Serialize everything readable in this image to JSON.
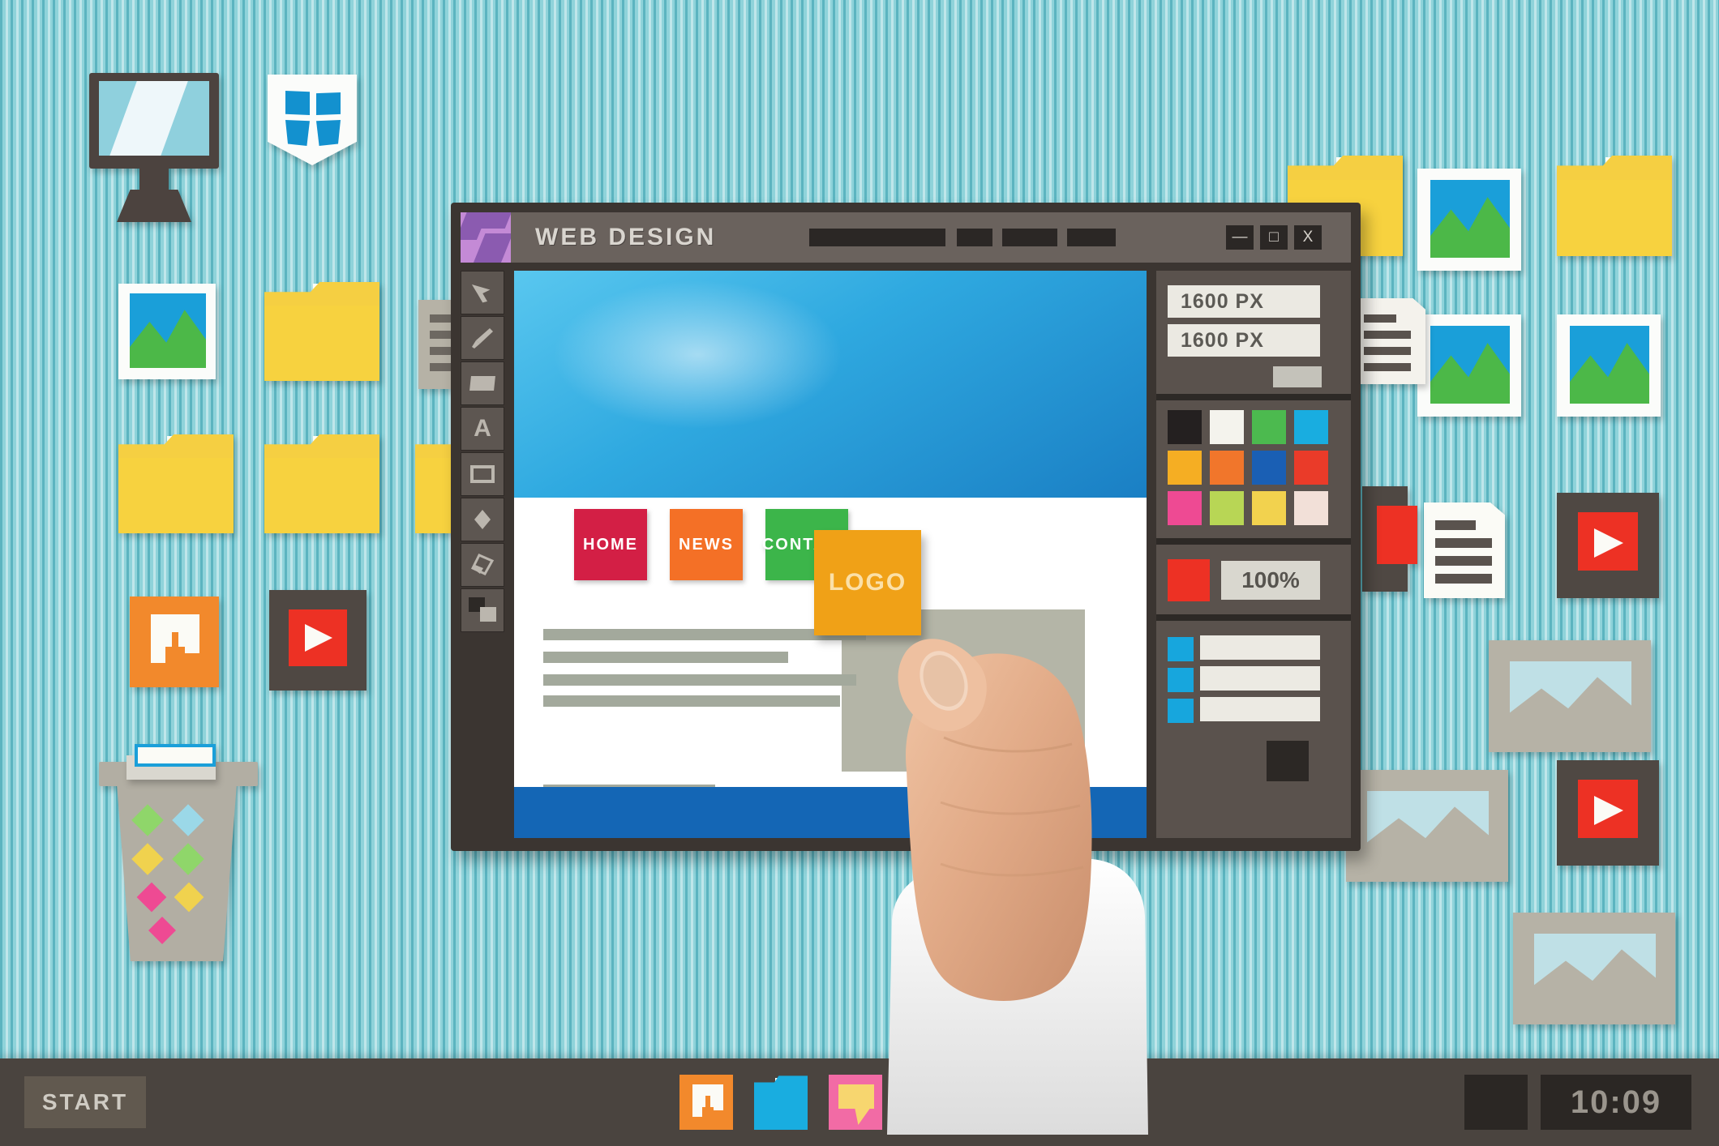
{
  "window": {
    "title": "WEB DESIGN",
    "logo_icon": "app-logo-icon",
    "controls": {
      "minimize": "—",
      "maximize": "□",
      "close": "X"
    }
  },
  "toolbar": {
    "tools": [
      {
        "name": "cursor-tool",
        "icon": "cursor-arrow-icon"
      },
      {
        "name": "brush-tool",
        "icon": "paintbrush-icon"
      },
      {
        "name": "fill-rect-tool",
        "icon": "filled-rectangle-icon"
      },
      {
        "name": "text-tool",
        "icon": "text-a-icon",
        "glyph": "A"
      },
      {
        "name": "rectangle-tool",
        "icon": "rectangle-outline-icon"
      },
      {
        "name": "shape-tool",
        "icon": "diamond-icon"
      },
      {
        "name": "eraser-tool",
        "icon": "eraser-icon"
      },
      {
        "name": "color-swatch-tool",
        "icon": "two-squares-icon"
      }
    ]
  },
  "canvas": {
    "nav": [
      {
        "label": "HOME",
        "color": "#d31f45"
      },
      {
        "label": "NEWS",
        "color": "#f47026"
      },
      {
        "label": "CONTACT",
        "color": "#3cb54a"
      }
    ],
    "logo_card": {
      "label": "LOGO",
      "color": "#f0a117"
    },
    "hero_color": "#2fa9e0",
    "footer_color": "#1466b5"
  },
  "side_panel": {
    "width_field": {
      "value": "1600 PX",
      "name": "width-field"
    },
    "height_field": {
      "value": "1600 PX",
      "name": "height-field"
    },
    "zoom": {
      "value": "100%",
      "swatch_color": "#ed3124"
    },
    "palette": [
      [
        "#242020",
        "#f4f3ed",
        "#4cba4f",
        "#19ade0"
      ],
      [
        "#f5ae23",
        "#f1762b",
        "#1a5fb4",
        "#ea3b29"
      ],
      [
        "#ee4a93",
        "#b8d655",
        "#f2d24e",
        "#f2e0d8"
      ]
    ],
    "layers": [
      {
        "marker": "#17a6dd"
      },
      {
        "marker": "#17a6dd"
      },
      {
        "marker": "#17a6dd"
      }
    ]
  },
  "taskbar": {
    "start_label": "START",
    "clock": "10:09",
    "icons": [
      {
        "name": "music-icon",
        "color": "#f2892c"
      },
      {
        "name": "folder-icon",
        "color": "#19ade0"
      },
      {
        "name": "chat-icon",
        "color": "#f26ba5"
      },
      {
        "name": "video-icon",
        "color": "#c9291f"
      }
    ]
  },
  "desktop_icons": [
    {
      "name": "monitor-icon",
      "type": "monitor"
    },
    {
      "name": "shield-icon",
      "type": "shield"
    },
    {
      "name": "picture-icon",
      "type": "image"
    },
    {
      "name": "folder-icon",
      "type": "folder"
    },
    {
      "name": "folder-icon",
      "type": "folder"
    },
    {
      "name": "folder-icon",
      "type": "folder"
    },
    {
      "name": "music-icon",
      "type": "music"
    },
    {
      "name": "video-icon",
      "type": "video"
    },
    {
      "name": "recycle-bin-icon",
      "type": "trash"
    },
    {
      "name": "document-icon",
      "type": "document"
    }
  ]
}
